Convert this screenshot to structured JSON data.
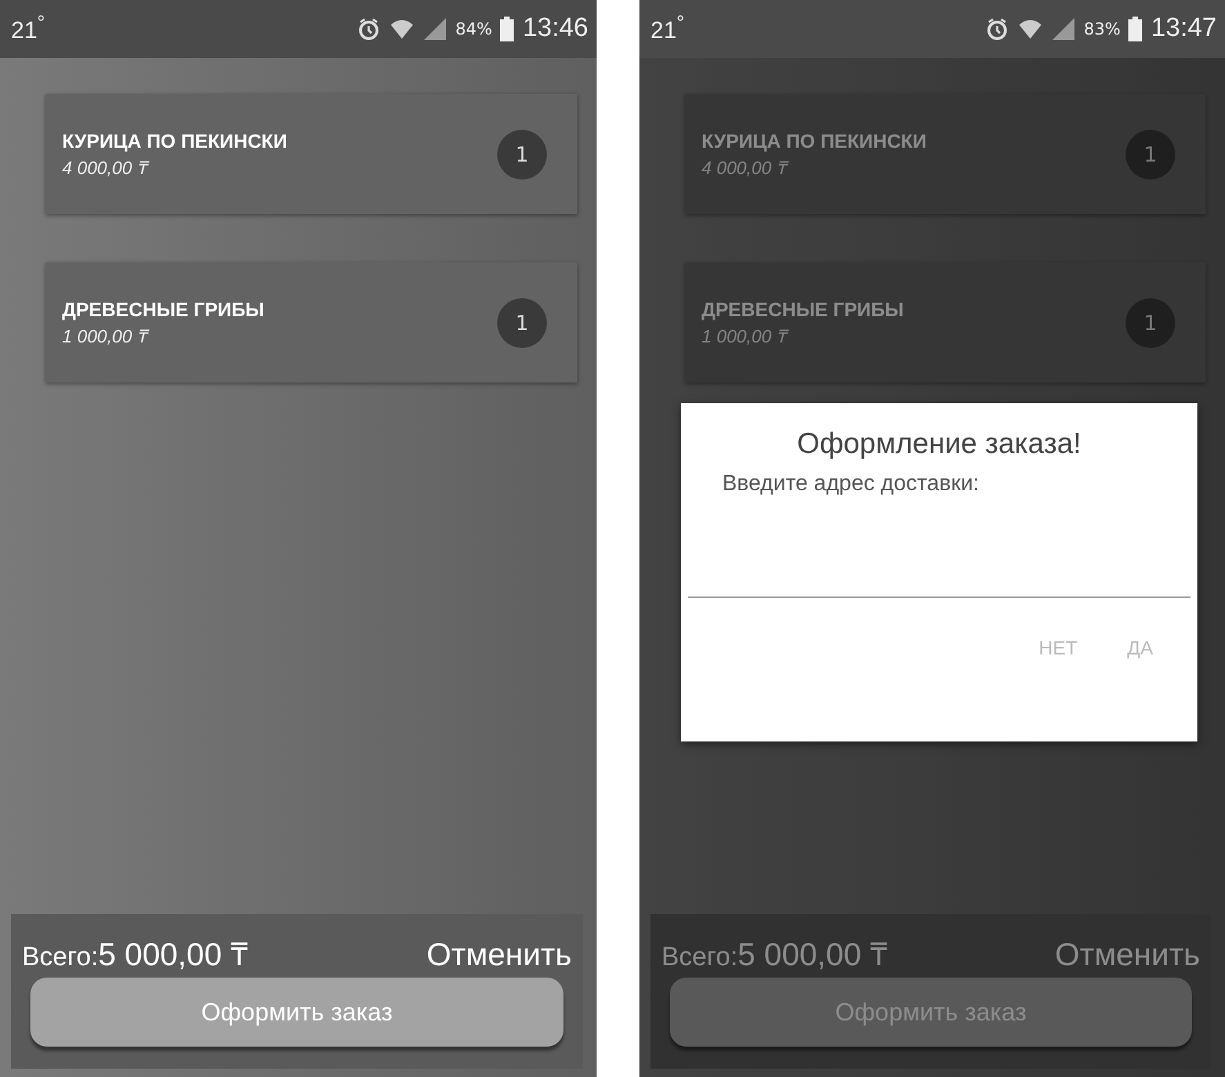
{
  "screens": [
    {
      "dimmed": false,
      "status_bar": {
        "temperature": "21$^{°}$",
        "battery": "84%",
        "time": "13:46"
      },
      "items": [
        {
          "name": "КУРИЦА ПО ПЕКИНСКИ",
          "price": "4 000,00 ₸",
          "quantity": "1"
        },
        {
          "name": "ДРЕВЕСНЫЕ ГРИБЫ",
          "price": "1 000,00 ₸",
          "quantity": "1"
        }
      ],
      "total_label": "Всего:",
      "total": "5 000,00 ₸",
      "cancel": "Отменить",
      "order_button": "Оформить заказ"
    },
    {
      "dimmed": true,
      "status_bar": {
        "temperature": "21$^{°}$",
        "battery": "83%",
        "time": "13:47"
      },
      "items": [
        {
          "name": "КУРИЦА ПО ПЕКИНСКИ",
          "price": "4 000,00 ₸",
          "quantity": "1"
        },
        {
          "name": "ДРЕВЕСНЫЕ ГРИБЫ",
          "price": "1 000,00 ₸",
          "quantity": "1"
        }
      ],
      "total_label": "Всего:",
      "total": "5 000,00 ₸",
      "cancel": "Отменить",
      "order_button": "Оформить заказ",
      "dialog": {
        "title": "Оформление заказа!",
        "prompt": "Введите адрес доставки:",
        "buttons": [
          "НЕТ",
          "ДА"
        ]
      }
    }
  ]
}
